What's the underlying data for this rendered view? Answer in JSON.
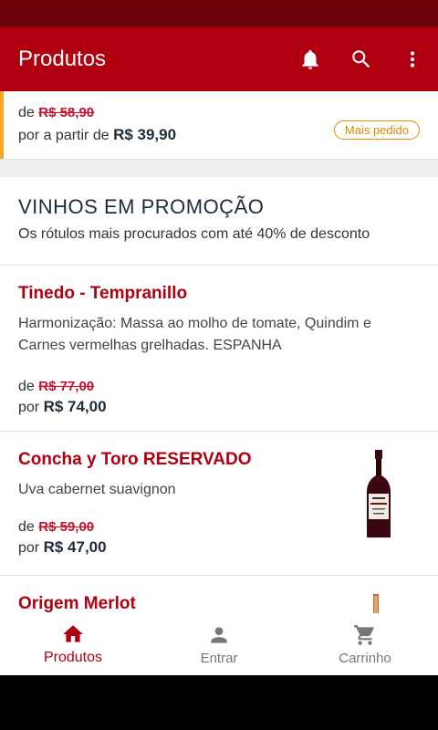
{
  "appbar": {
    "title": "Produtos",
    "icons": [
      "bell-icon",
      "search-icon",
      "more-vert-icon"
    ]
  },
  "top_card": {
    "from_prefix": "de",
    "old_price": "R$ 58,90",
    "from_label": "por a partir de",
    "price": "R$ 39,90",
    "badge": "Mais pedido"
  },
  "section": {
    "title": "VINHOS EM PROMOÇÃO",
    "subtitle": "Os rótulos mais procurados com até 40% de desconto"
  },
  "products": [
    {
      "name": "Tinedo - Tempranillo",
      "description": "Harmonização: Massa ao molho de tomate, Quindim e Carnes vermelhas grelhadas. ESPANHA",
      "de_label": "de",
      "old_price": "R$ 77,00",
      "por_label": "por",
      "price": "R$ 74,00"
    },
    {
      "name": "Concha y Toro RESERVADO",
      "description": "Uva cabernet suavignon",
      "de_label": "de",
      "old_price": "R$ 59,00",
      "por_label": "por",
      "price": "R$ 47,00",
      "image": "red-wine-bottle"
    },
    {
      "name": "Origem Merlot",
      "image": "wine-bottle"
    }
  ],
  "bottom_nav": [
    {
      "label": "Produtos",
      "icon": "home-icon",
      "active": true
    },
    {
      "label": "Entrar",
      "icon": "person-icon",
      "active": false
    },
    {
      "label": "Carrinho",
      "icon": "cart-icon",
      "active": false
    }
  ],
  "colors": {
    "primary": "#b0000f",
    "status_bar": "#6d0009",
    "accent": "#f5a623"
  }
}
